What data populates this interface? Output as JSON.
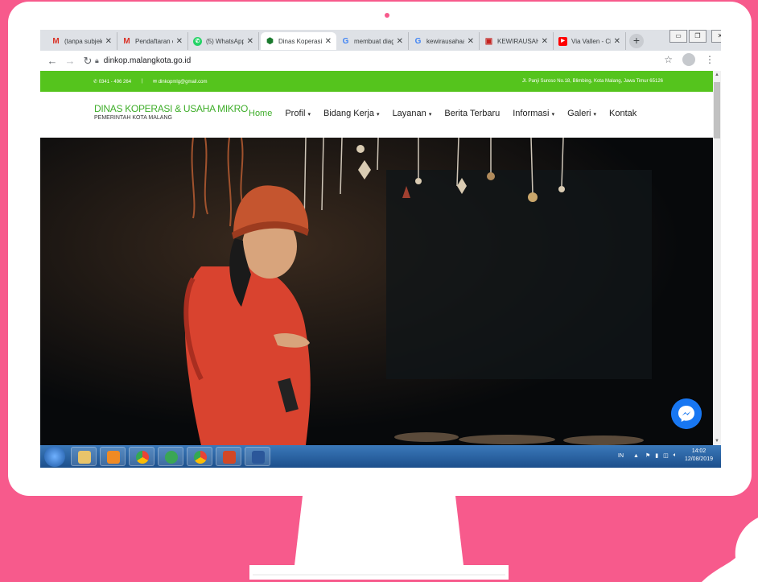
{
  "browser": {
    "tabs": [
      {
        "title": "(tanpa subjek)",
        "icon": "gmail-icon"
      },
      {
        "title": "Pendaftaran el",
        "icon": "gmail-icon"
      },
      {
        "title": "(5) WhatsApp",
        "icon": "whatsapp-icon"
      },
      {
        "title": "Dinas Koperasi",
        "icon": "site-favicon"
      },
      {
        "title": "membuat diag",
        "icon": "google-icon"
      },
      {
        "title": "kewirausahaan",
        "icon": "google-icon"
      },
      {
        "title": "KEWIRAUSAHA",
        "icon": "document-icon"
      },
      {
        "title": "Via Vallen - Ci",
        "icon": "youtube-icon"
      }
    ],
    "active_tab": 3,
    "url": "dinkop.malangkota.go.id"
  },
  "site": {
    "phone": "0341 - 496 264",
    "separator": "|",
    "email": "dinkopmlg@gmail.com",
    "address": "Jl. Panji Suroso No.18, Blimbing, Kota Malang, Jawa Timur 65126",
    "brand_title": "DINAS KOPERASI & USAHA MIKRO",
    "brand_subtitle": "PEMERINTAH KOTA MALANG",
    "menu": [
      {
        "label": "Home",
        "dropdown": false
      },
      {
        "label": "Profil",
        "dropdown": true
      },
      {
        "label": "Bidang Kerja",
        "dropdown": true
      },
      {
        "label": "Layanan",
        "dropdown": true
      },
      {
        "label": "Berita Terbaru",
        "dropdown": false
      },
      {
        "label": "Informasi",
        "dropdown": true
      },
      {
        "label": "Galeri",
        "dropdown": true
      },
      {
        "label": "Kontak",
        "dropdown": false
      }
    ],
    "active_menu": 0
  },
  "taskbar": {
    "language": "IN",
    "time": "14:02",
    "date": "12/08/2019"
  },
  "colors": {
    "background_pink": "#f75a8c",
    "site_green": "#55c41d",
    "brand_green": "#3fae2a",
    "messenger_blue": "#1877f2"
  }
}
